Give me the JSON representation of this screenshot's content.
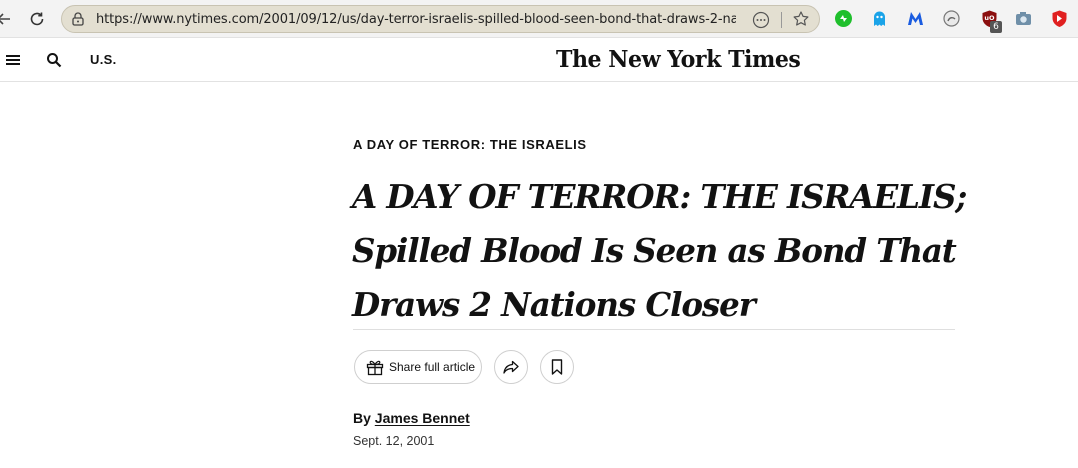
{
  "browser": {
    "url": "https://www.nytimes.com/2001/09/12/us/day-terror-israelis-spilled-blood-seen-bond-that-draws-2-na...",
    "extension_badge": "6",
    "icons": [
      "back-arrow-icon",
      "reload-icon",
      "lock-icon",
      "more-icon",
      "star-icon",
      "extension-icons"
    ]
  },
  "header": {
    "section": "U.S.",
    "logo": "The New York Times"
  },
  "article": {
    "kicker": "A DAY OF TERROR: THE ISRAELIS",
    "headline_lines": [
      "A DAY OF TERROR: THE ISRAELIS;",
      "Spilled Blood Is Seen as Bond That",
      "Draws 2 Nations Closer"
    ],
    "share_label": "Share full article",
    "byline_prefix": "By",
    "author": "James Bennet",
    "date": "Sept. 12, 2001"
  }
}
